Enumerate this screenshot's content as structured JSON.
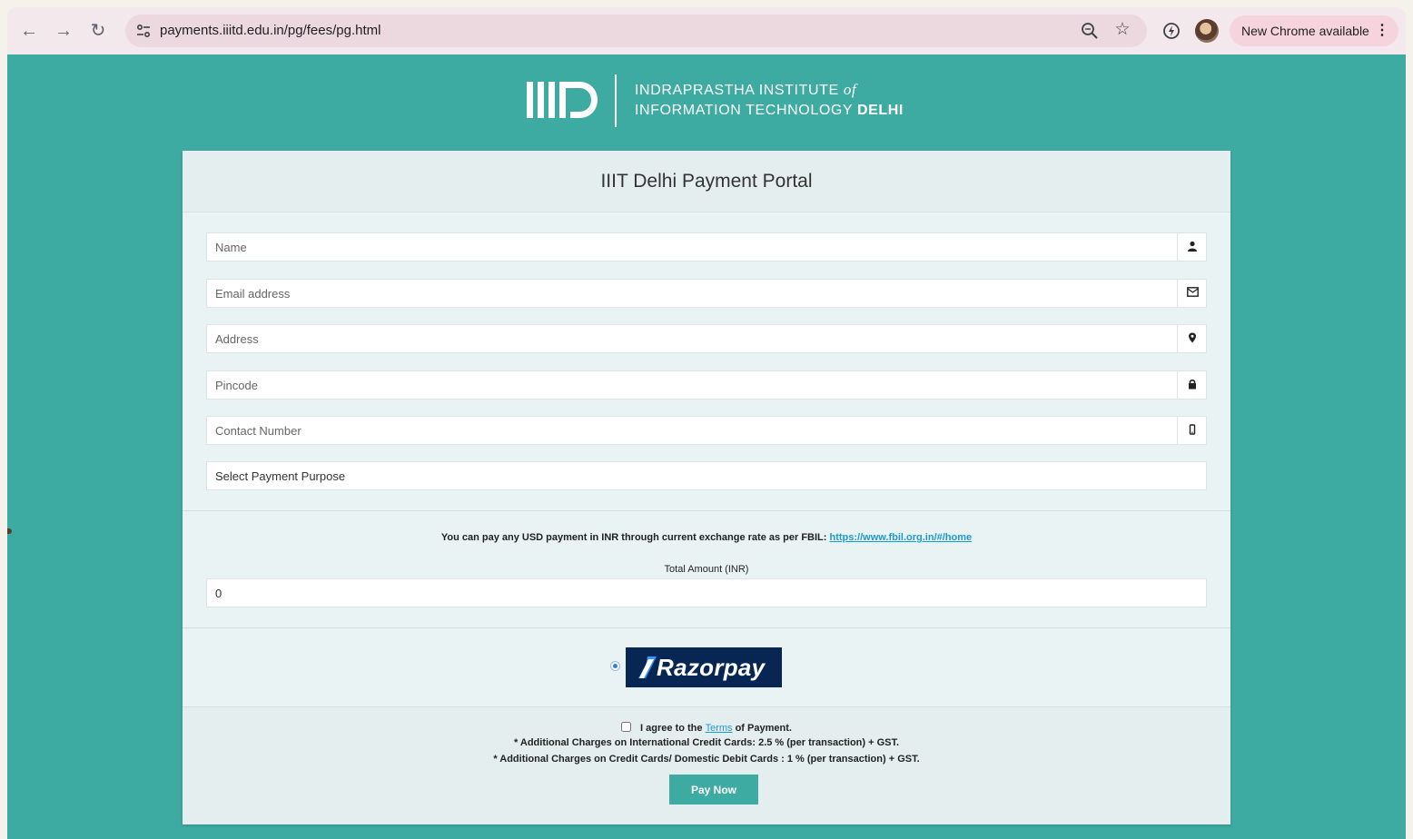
{
  "browser": {
    "url": "payments.iiitd.edu.in/pg/fees/pg.html",
    "update_label": "New Chrome available"
  },
  "header": {
    "logo_line1_prefix": "INDRAPRASTHA INSTITUTE ",
    "logo_line1_of": "of",
    "logo_line2_prefix": "INFORMATION TECHNOLOGY ",
    "logo_line2_bold": "DELHI"
  },
  "form": {
    "title": "IIIT Delhi Payment Portal",
    "name_placeholder": "Name",
    "email_placeholder": "Email address",
    "address_placeholder": "Address",
    "pincode_placeholder": "Pincode",
    "contact_placeholder": "Contact Number",
    "purpose_selected": "Select Payment Purpose",
    "info_text": "You can pay any USD payment in INR through current exchange rate as per FBIL: ",
    "info_link": "https://www.fbil.org.in/#/home",
    "amount_label": "Total Amount (INR)",
    "amount_value": "0",
    "gateway_label": "Razorpay",
    "agree_prefix": "I agree to the ",
    "agree_link": "Terms",
    "agree_suffix": " of Payment.",
    "note_international": "* Additional Charges on International Credit Cards: 2.5 % (per transaction) + GST.",
    "note_domestic": "* Additional Charges on Credit Cards/ Domestic Debit Cards : 1 % (per transaction) + GST.",
    "pay_button": "Pay Now"
  },
  "colors": {
    "page_bg": "#3eaba3",
    "card_bg": "#eaf3f3",
    "link": "#1a9bd7",
    "razorpay_bg": "#072654"
  },
  "icons": [
    "back-arrow-icon",
    "forward-arrow-icon",
    "reload-icon",
    "site-settings-icon",
    "zoom-icon",
    "bookmark-star-icon",
    "extension-icon",
    "user-icon",
    "envelope-icon",
    "map-marker-icon",
    "lock-icon",
    "mobile-icon"
  ]
}
